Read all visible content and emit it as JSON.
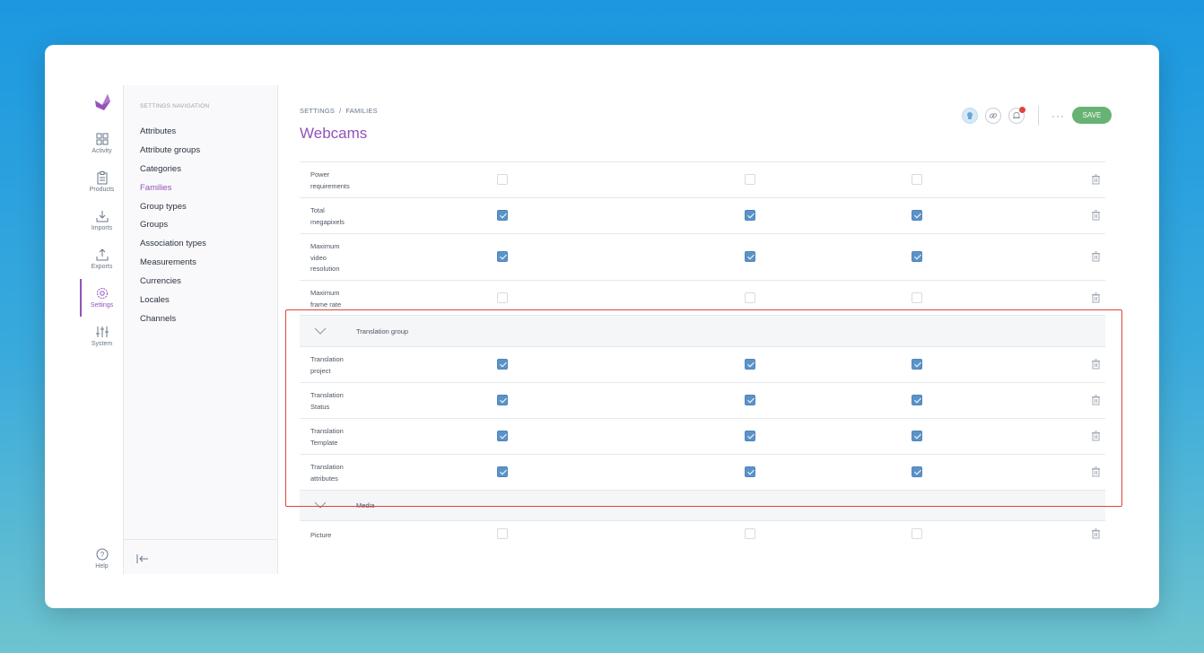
{
  "rail": {
    "items": [
      {
        "label": "Activity",
        "icon": "grid-icon"
      },
      {
        "label": "Products",
        "icon": "clipboard-icon"
      },
      {
        "label": "Imports",
        "icon": "import-icon"
      },
      {
        "label": "Exports",
        "icon": "export-icon"
      },
      {
        "label": "Settings",
        "icon": "gear-icon",
        "active": true
      },
      {
        "label": "System",
        "icon": "sliders-icon"
      }
    ],
    "help": "Help"
  },
  "subnav": {
    "title": "SETTINGS NAVIGATION",
    "items": [
      "Attributes",
      "Attribute groups",
      "Categories",
      "Families",
      "Group types",
      "Groups",
      "Association types",
      "Measurements",
      "Currencies",
      "Locales",
      "Channels"
    ],
    "active": "Families"
  },
  "header": {
    "breadcrumb": [
      "SETTINGS",
      "FAMILIES"
    ],
    "separator": "/",
    "title": "Webcams",
    "more": "···",
    "save": "SAVE"
  },
  "colors": {
    "accent": "#9452ba",
    "save": "#67b373",
    "checkbox": "#5b93c9",
    "highlight": "#e0443b"
  },
  "rows": [
    {
      "type": "attr",
      "label": [
        "Power",
        "requirements"
      ],
      "checks": [
        false,
        false,
        false
      ]
    },
    {
      "type": "attr",
      "label": [
        "Total",
        "megapixels"
      ],
      "checks": [
        true,
        true,
        true
      ]
    },
    {
      "type": "attr",
      "label": [
        "Maximum",
        "video",
        "resolution"
      ],
      "checks": [
        true,
        true,
        true
      ]
    },
    {
      "type": "attr",
      "label": [
        "Maximum",
        "frame rate"
      ],
      "checks": [
        false,
        false,
        false
      ]
    },
    {
      "type": "group",
      "label": "Translation group"
    },
    {
      "type": "attr",
      "label": [
        "Translation",
        "project"
      ],
      "checks": [
        true,
        true,
        true
      ]
    },
    {
      "type": "attr",
      "label": [
        "Translation",
        "Status"
      ],
      "checks": [
        true,
        true,
        true
      ]
    },
    {
      "type": "attr",
      "label": [
        "Translation",
        "Template"
      ],
      "checks": [
        true,
        true,
        true
      ]
    },
    {
      "type": "attr",
      "label": [
        "Translation",
        "attributes"
      ],
      "checks": [
        true,
        true,
        true
      ]
    },
    {
      "type": "group",
      "label": "Media"
    },
    {
      "type": "attr",
      "label": [
        "Picture"
      ],
      "checks": [
        false,
        false,
        false
      ]
    }
  ]
}
